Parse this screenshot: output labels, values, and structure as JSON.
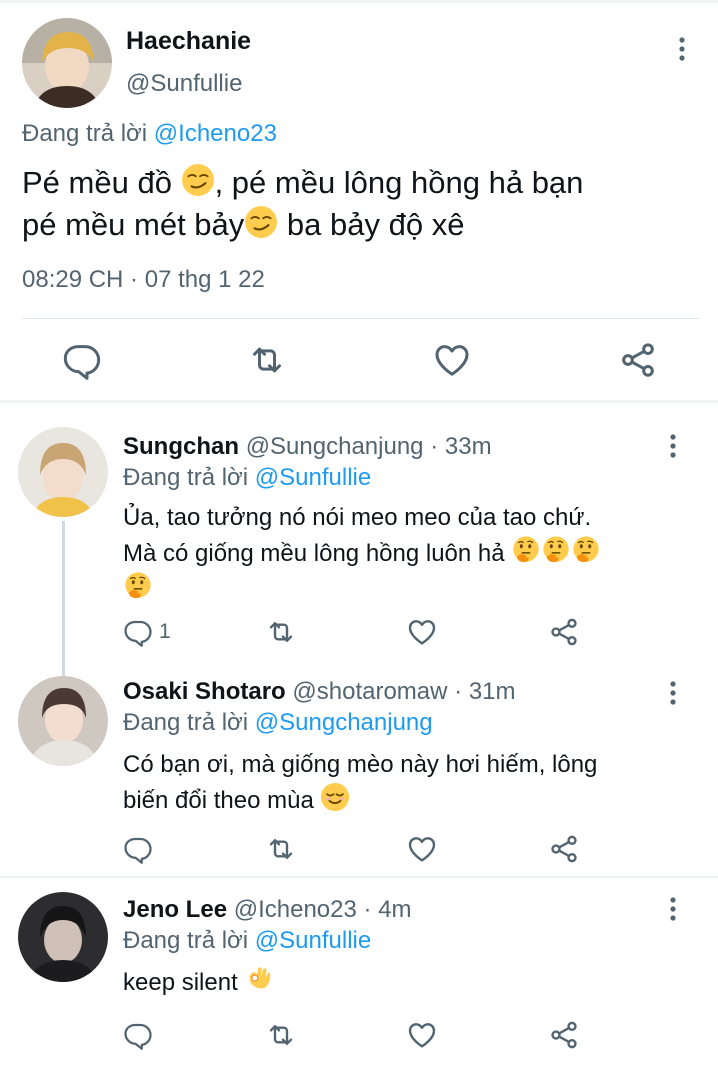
{
  "main_tweet": {
    "name": "Haechanie",
    "handle": "@Sunfullie",
    "reply_prefix": "Đang trả lời",
    "reply_mention": "@Icheno23",
    "text_line1a": "Pé mều đồ",
    "text_line1b": ", pé mều lông hồng hả bạn",
    "text_line2a": "pé mều mét bảy",
    "text_line2b": " ba bảy độ xê",
    "timestamp": "08:29 CH · 07 thg 1 22",
    "icons": [
      "reply-icon",
      "retweet-icon",
      "like-icon",
      "share-icon"
    ]
  },
  "replies": [
    {
      "name": "Sungchan",
      "handle": "@Sungchanjung",
      "dot": "·",
      "time": "33m",
      "reply_prefix": "Đang trả lời",
      "reply_mention": "@Sunfullie",
      "text_line1": "Ủa, tao tưởng nó nói meo meo của tao chứ.",
      "text_line2": "Mà có giống mều lông hồng luôn hả",
      "reply_count": "1"
    },
    {
      "name": "Osaki Shotaro",
      "handle": "@shotaromaw",
      "dot": "·",
      "time": "31m",
      "reply_prefix": "Đang trả lời",
      "reply_mention": "@Sungchanjung",
      "text_line1": "Có bạn ơi, mà giống mèo này hơi hiếm, lông",
      "text_line2": "biến đổi theo mùa"
    },
    {
      "name": "Jeno Lee",
      "handle": "@Icheno23",
      "dot": "·",
      "time": "4m",
      "reply_prefix": "Đang trả lời",
      "reply_mention": "@Sunfullie",
      "text_line1": "keep silent"
    }
  ],
  "colors": {
    "accent": "#1d9bf0",
    "secondary_text": "#536471",
    "primary_text": "#0f1419",
    "divider": "#eff3f4"
  }
}
